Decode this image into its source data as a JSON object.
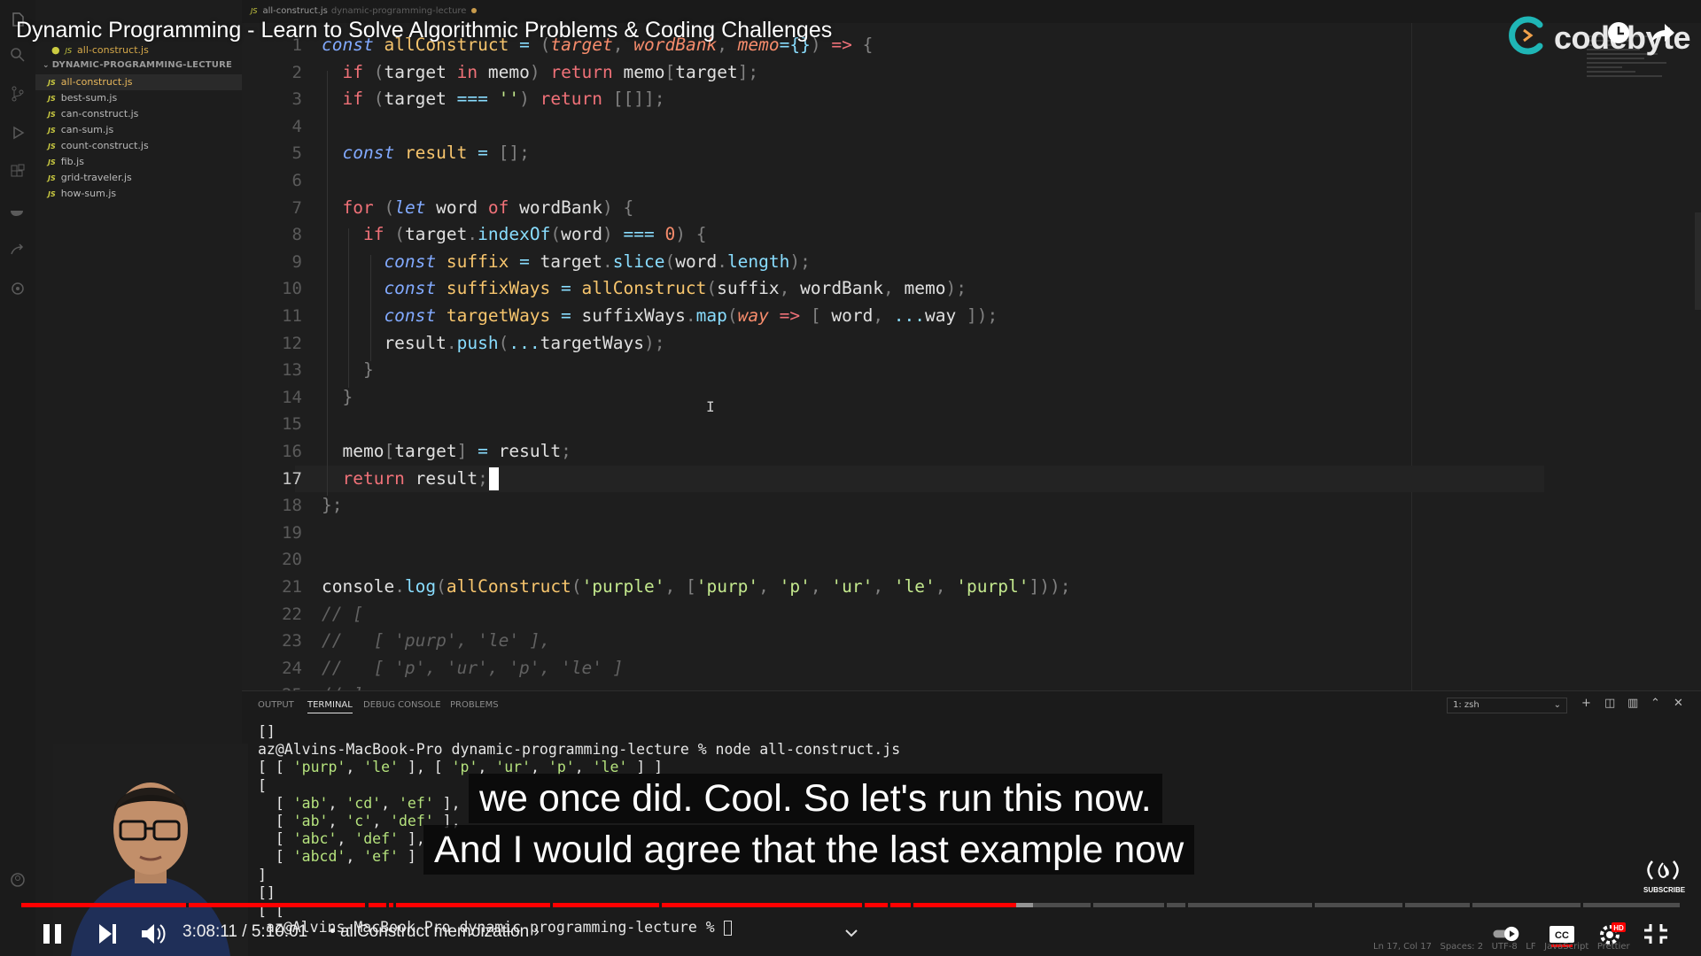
{
  "video": {
    "title": "Dynamic Programming - Learn to Solve Algorithmic Problems & Coding Challenges",
    "channel_brand": "codebyte",
    "time_current": "3:08:11",
    "time_total": "5:10:01",
    "chapter": "allConstruct memoization",
    "progress": 0.6,
    "buffered": 0.61,
    "captions": [
      "we once did. Cool. So let's run this now.",
      "And I would agree that the last example now"
    ],
    "subscribe_label": "SUBSCRIBE",
    "colors": {
      "progress": "#ff0000",
      "brand": "#1fb6b6"
    }
  },
  "editor": {
    "tab_file": "all-construct.js",
    "tab_folder": "dynamic-programming-lecture",
    "current_line": 17
  },
  "sidebar": {
    "open_file": "all-construct.js",
    "folder": "DYNAMIC-PROGRAMMING-LECTURE",
    "files": [
      {
        "name": "all-construct.js",
        "active": true
      },
      {
        "name": "best-sum.js",
        "active": false
      },
      {
        "name": "can-construct.js",
        "active": false
      },
      {
        "name": "can-sum.js",
        "active": false
      },
      {
        "name": "count-construct.js",
        "active": false
      },
      {
        "name": "fib.js",
        "active": false
      },
      {
        "name": "grid-traveler.js",
        "active": false
      },
      {
        "name": "how-sum.js",
        "active": false
      }
    ]
  },
  "panel": {
    "tabs": [
      "OUTPUT",
      "TERMINAL",
      "DEBUG CONSOLE",
      "PROBLEMS"
    ],
    "active_tab": "TERMINAL",
    "terminal_select": "1: zsh",
    "lines": [
      "[]",
      "az@Alvins-MacBook-Pro dynamic-programming-lecture % node all-construct.js",
      "[ [ 'purp', 'le' ], [ 'p', 'ur', 'p', 'le' ] ]",
      "[",
      "  [ 'ab', 'cd', 'ef' ],",
      "  [ 'ab', 'c', 'def' ],",
      "  [ 'abc', 'def' ],",
      "  [ 'abcd', 'ef' ]",
      "]",
      "[]",
      "[ ["
    ],
    "prompt": "az@Alvins-MacBook-Pro dynamic-programming-lecture % "
  },
  "statusbar": "Ln 17, Col 17   Spaces: 2   UTF-8   LF   JavaScript   Prettier"
}
